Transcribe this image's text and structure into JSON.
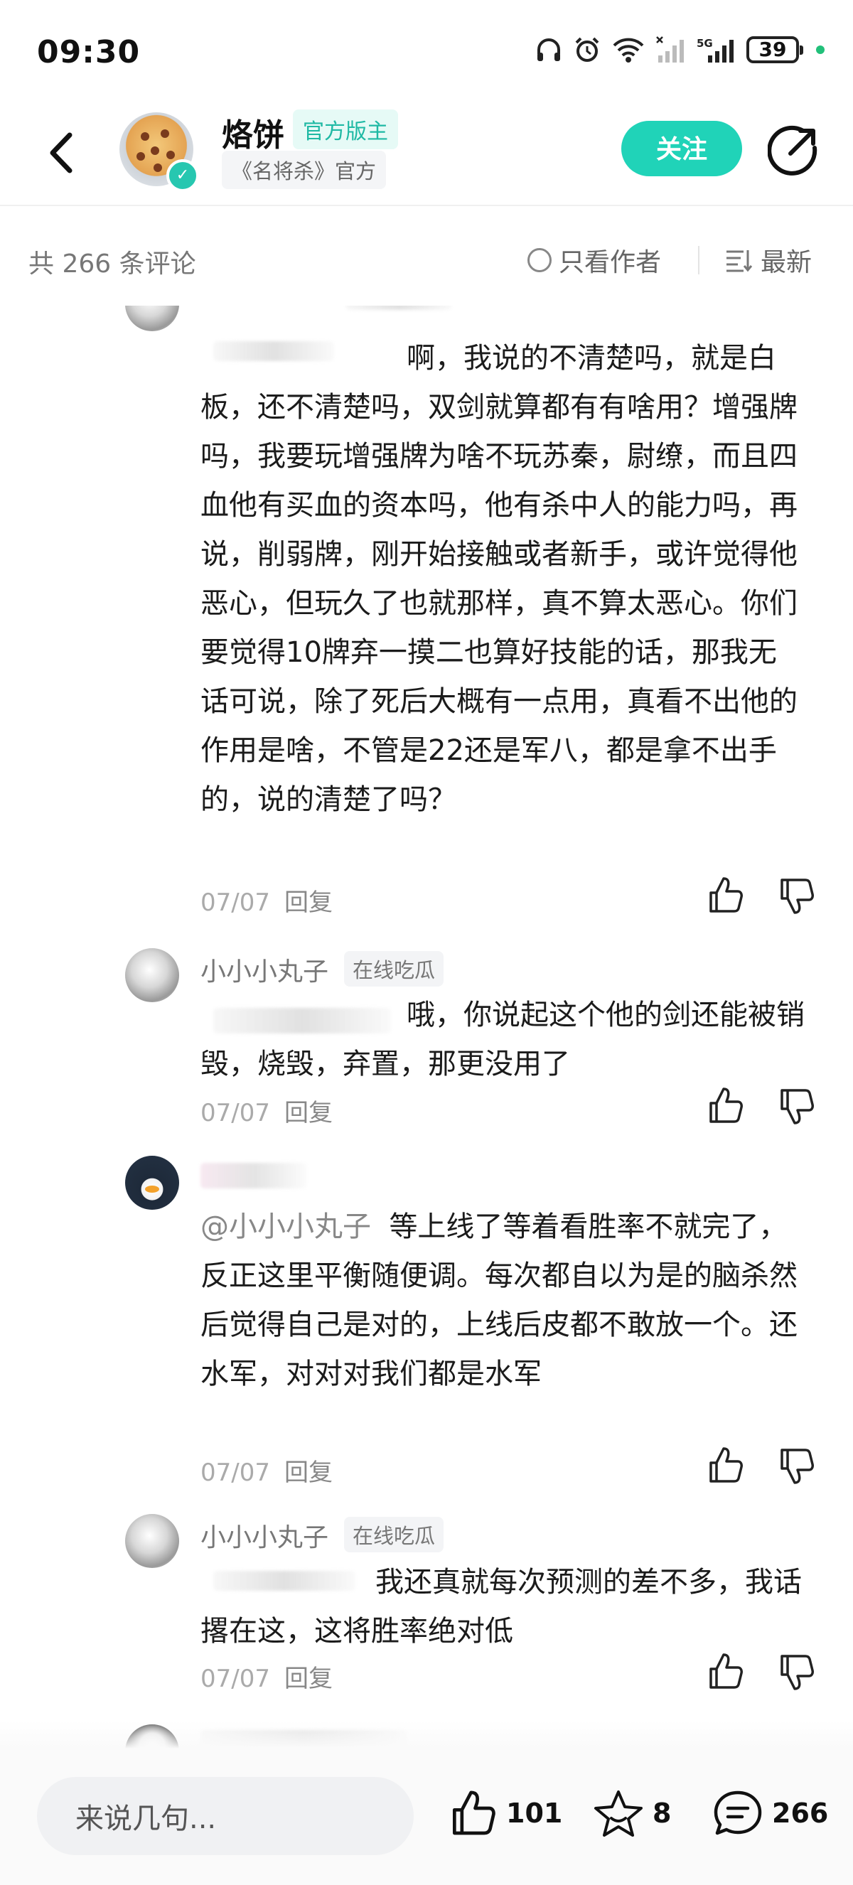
{
  "status_bar": {
    "time": "09:30",
    "battery": "39",
    "network": "5G",
    "icons": [
      "headset-icon",
      "alarm-icon",
      "wifi-icon",
      "signal-off-icon",
      "signal-5g-icon",
      "battery-icon",
      "charging-dot"
    ]
  },
  "header": {
    "name": "烙饼",
    "badge": "官方版主",
    "subtitle": "《名将杀》官方",
    "follow_label": "关注",
    "accent_color": "#20d3b8"
  },
  "filters": {
    "count_label": "共 266 条评论",
    "only_author_label": "只看作者",
    "sort_label": "最新"
  },
  "comments": [
    {
      "user": "",
      "tag": "",
      "text": "啊，我说的不清楚吗，就是白板，还不清楚吗，双剑就算都有有啥用？增强牌吗，我要玩增强牌为啥不玩苏秦，尉缭，而且四血他有买血的资本吗，他有杀中人的能力吗，再说，削弱牌，刚开始接触或者新手，或许觉得他恶心，但玩久了也就那样，真不算太恶心。你们要觉得10牌弃一摸二也算好技能的话，那我无话可说，除了死后大概有一点用，真看不出他的作用是啥，不管是22还是军八，都是拿不出手的，说的清楚了吗？",
      "date": "07/07",
      "reply_label": "回复"
    },
    {
      "user": "小小小丸子",
      "tag": "在线吃瓜",
      "text": "哦，你说起这个他的剑还能被销毁，烧毁，弃置，那更没用了",
      "date": "07/07",
      "reply_label": "回复"
    },
    {
      "user": "",
      "tag": "",
      "mention": "@小小小丸子",
      "text": "等上线了等着看胜率不就完了，反正这里平衡随便调。每次都自以为是的脑杀然后觉得自己是对的，上线后皮都不敢放一个。还水军，对对对我们都是水军",
      "date": "07/07",
      "reply_label": "回复"
    },
    {
      "user": "小小小丸子",
      "tag": "在线吃瓜",
      "text": "我还真就每次预测的差不多，我话撂在这，这将胜率绝对低",
      "date": "07/07",
      "reply_label": "回复"
    }
  ],
  "bottom_bar": {
    "input_placeholder": "来说几句...",
    "like_count": "101",
    "favorite_count": "8",
    "comment_count": "266"
  }
}
